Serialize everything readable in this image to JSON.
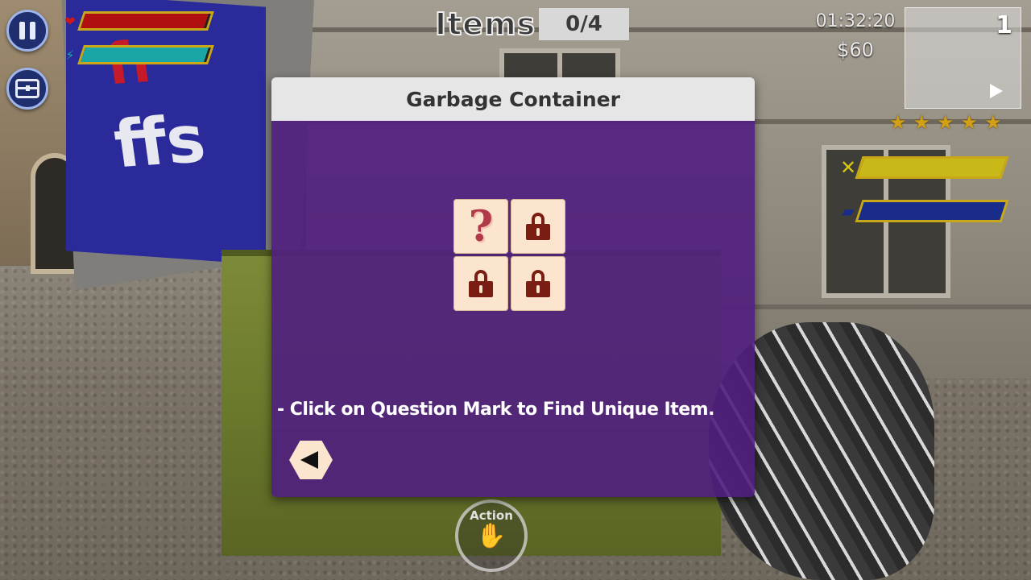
{
  "hud": {
    "items_label": "Items",
    "items_count": "0/4",
    "timer": "01:32:20",
    "money": "$60",
    "level": "1",
    "stars": [
      "★",
      "★",
      "★",
      "★",
      "★"
    ],
    "health_fill": 0.98,
    "energy_fill": 0.98,
    "hunger_fill": 1.0,
    "thirst_fill": 1.0,
    "action_label": "Action"
  },
  "scene": {
    "billboard_text": "ffs",
    "billboard_red_text": "fr"
  },
  "dialog": {
    "title": "Garbage Container",
    "hint": "- Click on Question Mark to Find Unique Item.",
    "slots": [
      {
        "type": "question",
        "glyph": "?"
      },
      {
        "type": "locked"
      },
      {
        "type": "locked"
      },
      {
        "type": "locked"
      }
    ]
  },
  "icons": {
    "pause": "pause-icon",
    "inventory": "chest-icon",
    "health": "heart-icon",
    "energy": "lightning-icon",
    "hunger": "fork-knife-icon",
    "thirst": "drop-icon",
    "back": "back-arrow-icon",
    "action": "hand-icon"
  },
  "colors": {
    "dialog_body": "#501e80",
    "dialog_header": "#e6e6e6",
    "slot_bg": "#fbe5cf",
    "lock": "#7a1e14",
    "health": "#b01010",
    "energy": "#1aa6a6",
    "hunger": "#c8b818",
    "thirst": "#1a2c8a",
    "star": "#d1a017"
  }
}
